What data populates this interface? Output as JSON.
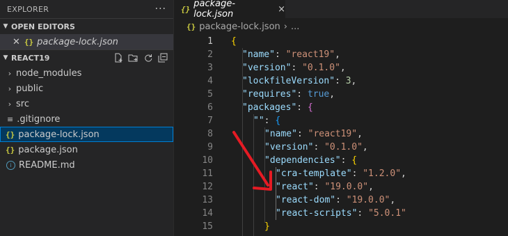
{
  "explorer": {
    "title": "EXPLORER",
    "more": "···",
    "open_editors": {
      "title": "OPEN EDITORS",
      "items": [
        {
          "label": "package-lock.json",
          "icon": "{}"
        }
      ]
    },
    "project": {
      "title": "REACT19",
      "items": [
        {
          "label": "node_modules",
          "type": "folder"
        },
        {
          "label": "public",
          "type": "folder"
        },
        {
          "label": "src",
          "type": "folder"
        },
        {
          "label": ".gitignore",
          "type": "file"
        },
        {
          "label": "package-lock.json",
          "type": "json"
        },
        {
          "label": "package.json",
          "type": "json"
        },
        {
          "label": "README.md",
          "type": "info"
        }
      ]
    }
  },
  "tab": {
    "label": "package-lock.json",
    "icon": "{}",
    "close": "×"
  },
  "breadcrumb": {
    "file": "package-lock.json",
    "sep": "›",
    "rest": "..."
  },
  "code": {
    "lines": [
      {
        "num": "1",
        "indent": 0,
        "parts": [
          {
            "c": "br1",
            "t": "{"
          }
        ]
      },
      {
        "num": "2",
        "indent": 1,
        "parts": [
          {
            "c": "k",
            "t": "\"name\""
          },
          {
            "c": "p",
            "t": ": "
          },
          {
            "c": "s",
            "t": "\"react19\""
          },
          {
            "c": "p",
            "t": ","
          }
        ]
      },
      {
        "num": "3",
        "indent": 1,
        "parts": [
          {
            "c": "k",
            "t": "\"version\""
          },
          {
            "c": "p",
            "t": ": "
          },
          {
            "c": "s",
            "t": "\"0.1.0\""
          },
          {
            "c": "p",
            "t": ","
          }
        ]
      },
      {
        "num": "4",
        "indent": 1,
        "parts": [
          {
            "c": "k",
            "t": "\"lockfileVersion\""
          },
          {
            "c": "p",
            "t": ": "
          },
          {
            "c": "n",
            "t": "3"
          },
          {
            "c": "p",
            "t": ","
          }
        ]
      },
      {
        "num": "5",
        "indent": 1,
        "parts": [
          {
            "c": "k",
            "t": "\"requires\""
          },
          {
            "c": "p",
            "t": ": "
          },
          {
            "c": "b",
            "t": "true"
          },
          {
            "c": "p",
            "t": ","
          }
        ]
      },
      {
        "num": "6",
        "indent": 1,
        "parts": [
          {
            "c": "k",
            "t": "\"packages\""
          },
          {
            "c": "p",
            "t": ": "
          },
          {
            "c": "br2",
            "t": "{"
          }
        ]
      },
      {
        "num": "7",
        "indent": 2,
        "parts": [
          {
            "c": "k",
            "t": "\"\""
          },
          {
            "c": "p",
            "t": ": "
          },
          {
            "c": "br3",
            "t": "{"
          }
        ]
      },
      {
        "num": "8",
        "indent": 3,
        "parts": [
          {
            "c": "k",
            "t": "\"name\""
          },
          {
            "c": "p",
            "t": ": "
          },
          {
            "c": "s",
            "t": "\"react19\""
          },
          {
            "c": "p",
            "t": ","
          }
        ]
      },
      {
        "num": "9",
        "indent": 3,
        "parts": [
          {
            "c": "k",
            "t": "\"version\""
          },
          {
            "c": "p",
            "t": ": "
          },
          {
            "c": "s",
            "t": "\"0.1.0\""
          },
          {
            "c": "p",
            "t": ","
          }
        ]
      },
      {
        "num": "10",
        "indent": 3,
        "parts": [
          {
            "c": "k",
            "t": "\"dependencies\""
          },
          {
            "c": "p",
            "t": ": "
          },
          {
            "c": "br1",
            "t": "{"
          }
        ]
      },
      {
        "num": "11",
        "indent": 4,
        "parts": [
          {
            "c": "k",
            "t": "\"cra-template\""
          },
          {
            "c": "p",
            "t": ": "
          },
          {
            "c": "s",
            "t": "\"1.2.0\""
          },
          {
            "c": "p",
            "t": ","
          }
        ]
      },
      {
        "num": "12",
        "indent": 4,
        "parts": [
          {
            "c": "k",
            "t": "\"react\""
          },
          {
            "c": "p",
            "t": ": "
          },
          {
            "c": "s",
            "t": "\"19.0.0\""
          },
          {
            "c": "p",
            "t": ","
          }
        ]
      },
      {
        "num": "13",
        "indent": 4,
        "parts": [
          {
            "c": "k",
            "t": "\"react-dom\""
          },
          {
            "c": "p",
            "t": ": "
          },
          {
            "c": "s",
            "t": "\"19.0.0\""
          },
          {
            "c": "p",
            "t": ","
          }
        ]
      },
      {
        "num": "14",
        "indent": 4,
        "parts": [
          {
            "c": "k",
            "t": "\"react-scripts\""
          },
          {
            "c": "p",
            "t": ": "
          },
          {
            "c": "s",
            "t": "\"5.0.1\""
          }
        ]
      },
      {
        "num": "15",
        "indent": 3,
        "parts": [
          {
            "c": "br1",
            "t": "}"
          }
        ]
      }
    ]
  },
  "colors": {
    "accent": "#007fd4",
    "arrow": "#e51b24",
    "json_icon": "#cbcb41"
  }
}
